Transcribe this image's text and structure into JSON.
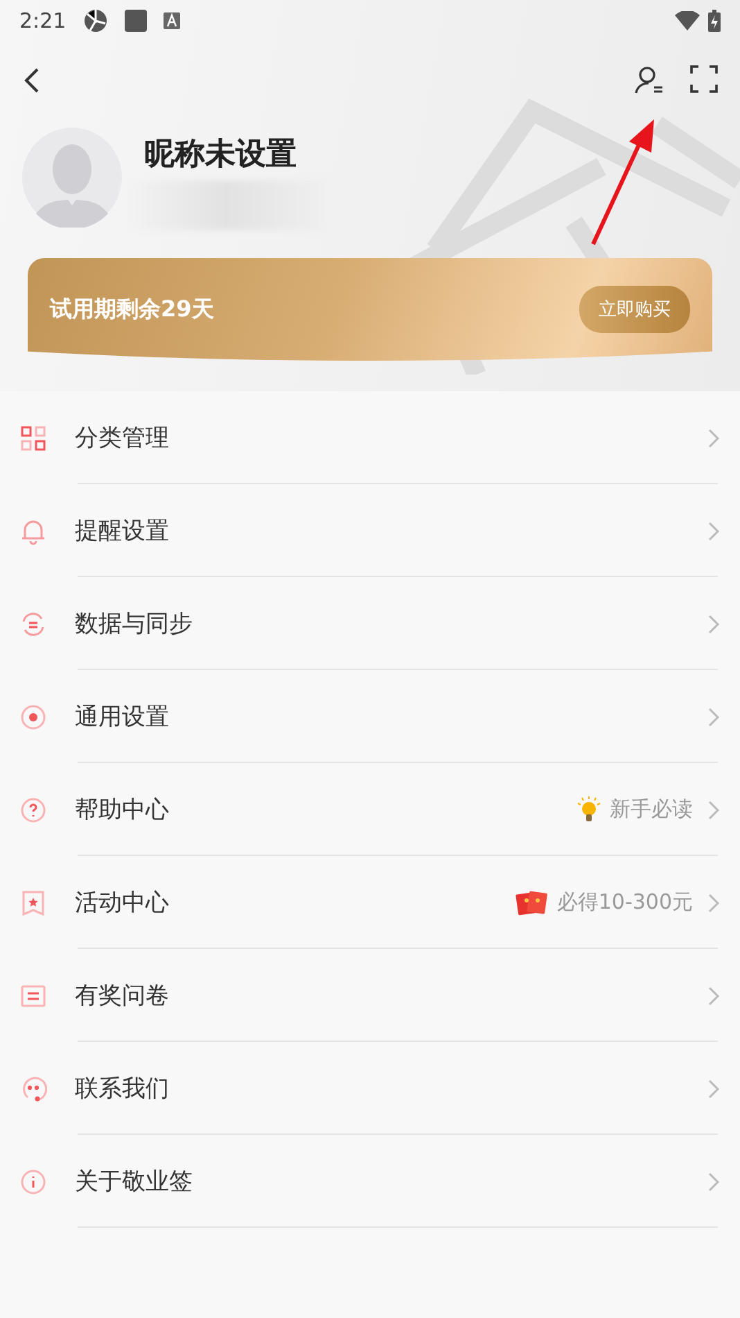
{
  "status_bar": {
    "time": "2:21"
  },
  "profile": {
    "nickname": "昵称未设置"
  },
  "trial_banner": {
    "text": "试用期剩余29天",
    "button": "立即购买"
  },
  "menu": [
    {
      "kind": "grid",
      "label": "分类管理"
    },
    {
      "kind": "bell",
      "label": "提醒设置"
    },
    {
      "kind": "sync",
      "label": "数据与同步"
    },
    {
      "kind": "dot",
      "label": "通用设置"
    },
    {
      "kind": "help",
      "label": "帮助中心",
      "hint": {
        "kind": "bulb",
        "text": "新手必读"
      }
    },
    {
      "kind": "star",
      "label": "活动中心",
      "hint": {
        "kind": "envelope",
        "text": "必得10-300元"
      }
    },
    {
      "kind": "form",
      "label": "有奖问卷"
    },
    {
      "kind": "chat",
      "label": "联系我们"
    },
    {
      "kind": "info",
      "label": "关于敬业签"
    }
  ]
}
